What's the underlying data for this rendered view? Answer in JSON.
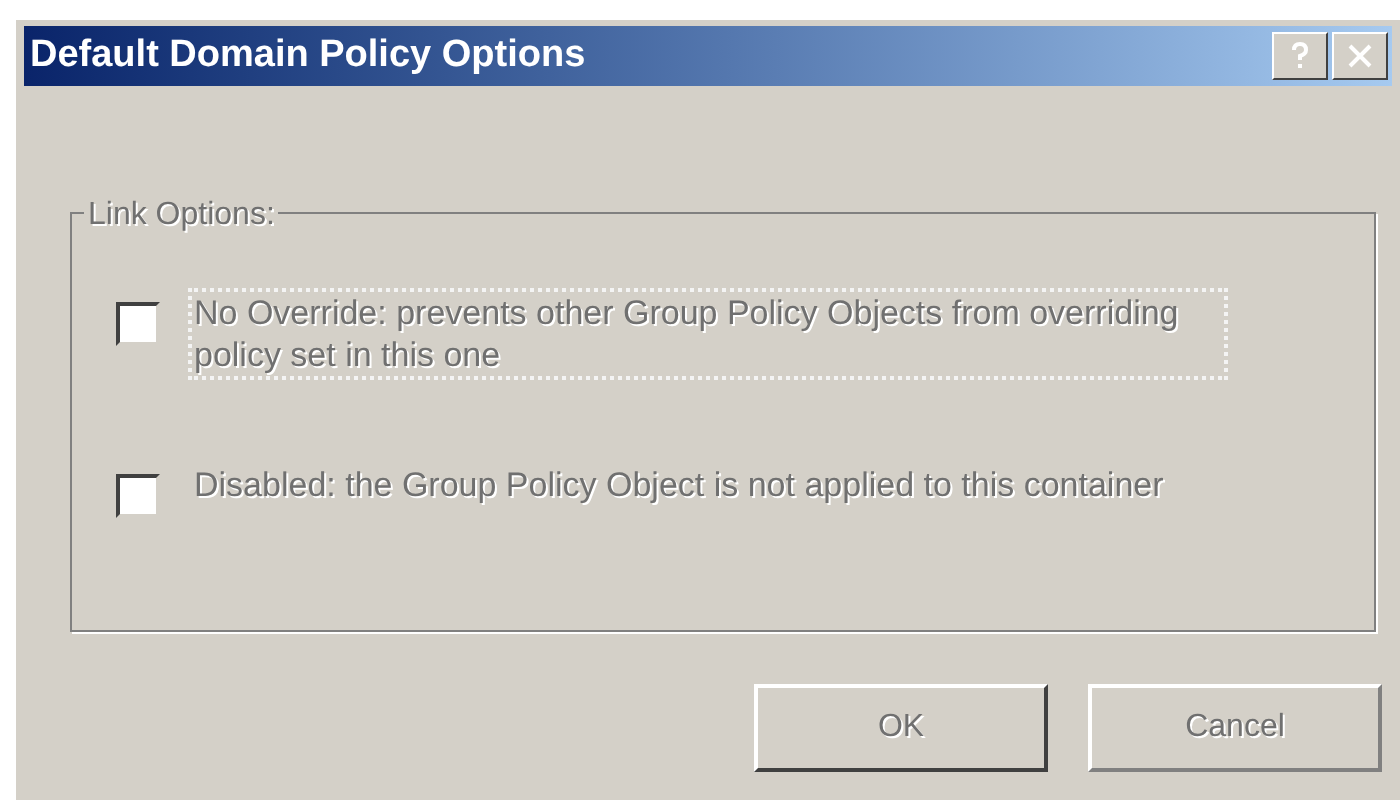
{
  "window": {
    "title": "Default Domain Policy Options"
  },
  "group": {
    "label": "Link Options:"
  },
  "options": [
    {
      "text": "No Override: prevents other Group Policy Objects from overriding policy set in this one",
      "checked": false,
      "focused": true
    },
    {
      "text": "Disabled: the Group Policy Object is not applied to this container",
      "checked": false,
      "focused": false
    }
  ],
  "buttons": [
    "OK",
    "Cancel"
  ]
}
